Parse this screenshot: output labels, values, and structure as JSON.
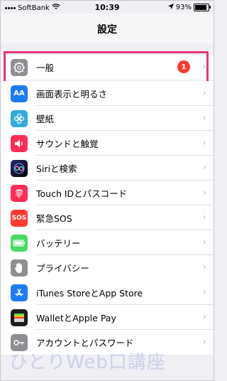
{
  "status": {
    "carrier": "SoftBank",
    "time": "10:39",
    "battery": "93%",
    "battery_level": 0.93
  },
  "nav": {
    "title": "設定"
  },
  "group1": [
    {
      "label": "一般",
      "icon": "gear-icon",
      "color": "#8e8e93",
      "badge": "1"
    }
  ],
  "group2": [
    {
      "label": "画面表示と明るさ",
      "icon": "aa-icon",
      "color": "#1e7cf2"
    },
    {
      "label": "壁紙",
      "icon": "flower-icon",
      "color": "#34aadc"
    },
    {
      "label": "サウンドと触覚",
      "icon": "speaker-icon",
      "color": "#ff2d55"
    },
    {
      "label": "Siriと検索",
      "icon": "siri-icon",
      "color": "#222222"
    },
    {
      "label": "Touch IDとパスコード",
      "icon": "fingerprint-icon",
      "color": "#ff2d55"
    },
    {
      "label": "緊急SOS",
      "icon": "sos-icon",
      "color": "#ff3b30"
    },
    {
      "label": "バッテリー",
      "icon": "battery-icon",
      "color": "#4cd964"
    },
    {
      "label": "プライバシー",
      "icon": "hand-icon",
      "color": "#8e8e93"
    }
  ],
  "group3": [
    {
      "label": "iTunes StoreとApp Store",
      "icon": "app-store-icon",
      "color": "#1e7cf2"
    },
    {
      "label": "WalletとApple Pay",
      "icon": "wallet-icon",
      "color": "#1c1c1e"
    },
    {
      "label": "アカウントとパスワード",
      "icon": "key-icon",
      "color": "#8e8e93"
    }
  ],
  "watermark": "ひとりWeb口講座"
}
